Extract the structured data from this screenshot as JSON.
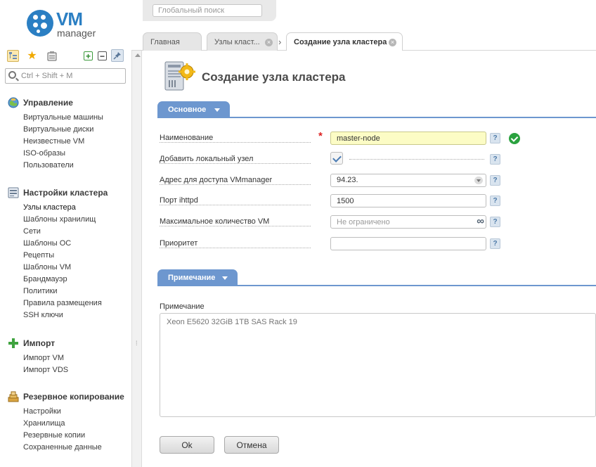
{
  "logo": {
    "brand": "VM",
    "product": "manager"
  },
  "topbar": {
    "search_placeholder": "Глобальный поиск"
  },
  "sidebar": {
    "search_placeholder": "Ctrl + Shift + M",
    "sections": [
      {
        "title": "Управление",
        "items": [
          "Виртуальные машины",
          "Виртуальные диски",
          "Неизвестные VM",
          "ISO-образы",
          "Пользователи"
        ]
      },
      {
        "title": "Настройки кластера",
        "items": [
          "Узлы кластера",
          "Шаблоны хранилищ",
          "Сети",
          "Шаблоны ОС",
          "Рецепты",
          "Шаблоны VM",
          "Брандмауэр",
          "Политики",
          "Правила размещения",
          "SSH ключи"
        ]
      },
      {
        "title": "Импорт",
        "items": [
          "Импорт VM",
          "Импорт VDS"
        ]
      },
      {
        "title": "Резервное копирование",
        "items": [
          "Настройки",
          "Хранилища",
          "Резервные копии",
          "Сохраненные данные"
        ]
      }
    ]
  },
  "tabs": [
    {
      "label": "Главная"
    },
    {
      "label": "Узлы клаcт...",
      "closable": true
    },
    {
      "label": "Создание узла кластера",
      "closable": true,
      "active": true
    }
  ],
  "page": {
    "title": "Создание узла кластера",
    "section_main": "Основное",
    "section_note": "Примечание",
    "fields": {
      "name": {
        "label": "Наименование",
        "value": "master-node",
        "required": true,
        "valid": true
      },
      "add_local": {
        "label": "Добавить локальный узел",
        "checked": true
      },
      "address": {
        "label": "Адрес для доступа VMmanager",
        "value": "94.23."
      },
      "port": {
        "label": "Порт ihttpd",
        "value": "1500"
      },
      "max_vm": {
        "label": "Максимальное количество VM",
        "placeholder": "Не ограничено"
      },
      "priority": {
        "label": "Приоритет",
        "value": ""
      }
    },
    "help_symbol": "?",
    "note": {
      "label": "Примечание",
      "placeholder": "Xeon E5620 32GiB 1TB SAS Rack 19"
    }
  },
  "buttons": {
    "ok": "Ok",
    "cancel": "Отмена"
  },
  "colors": {
    "accent": "#6d97cf",
    "brand": "#2b7fc3",
    "valid_bg": "#fcfcc5",
    "ok_green": "#2aa23f",
    "required": "#d22222"
  }
}
